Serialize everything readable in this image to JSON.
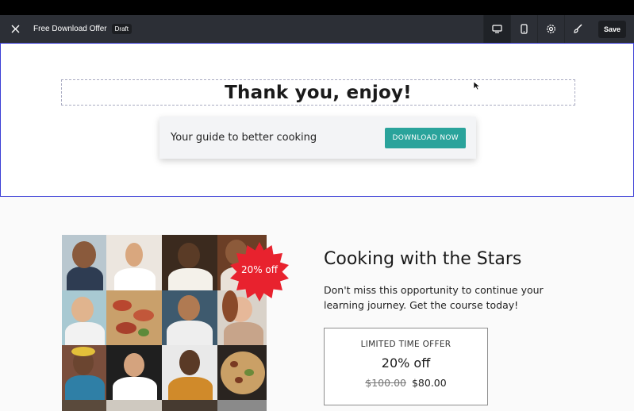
{
  "toolbar": {
    "title": "Free Download Offer",
    "badge": "Draft",
    "save_label": "Save",
    "icons": [
      "close-icon",
      "desktop-icon",
      "mobile-icon",
      "settings-icon",
      "brush-icon"
    ]
  },
  "thankyou": {
    "heading": "Thank you, enjoy!",
    "offer_text": "Your guide to better cooking",
    "download_label": "DOWNLOAD NOW"
  },
  "course": {
    "badge": "20% off",
    "title": "Cooking with the Stars",
    "description": "Don't miss this opportunity to continue your learning journey. Get the course today!",
    "price_label": "LIMITED TIME OFFER",
    "discount": "20% off",
    "old_price": "$100.00",
    "new_price": "$80.00"
  },
  "colors": {
    "toolbar_bg": "#2c2f36",
    "selection_border": "#3b3fd6",
    "button_teal": "#2aa39b",
    "badge_red": "#e8222e"
  }
}
